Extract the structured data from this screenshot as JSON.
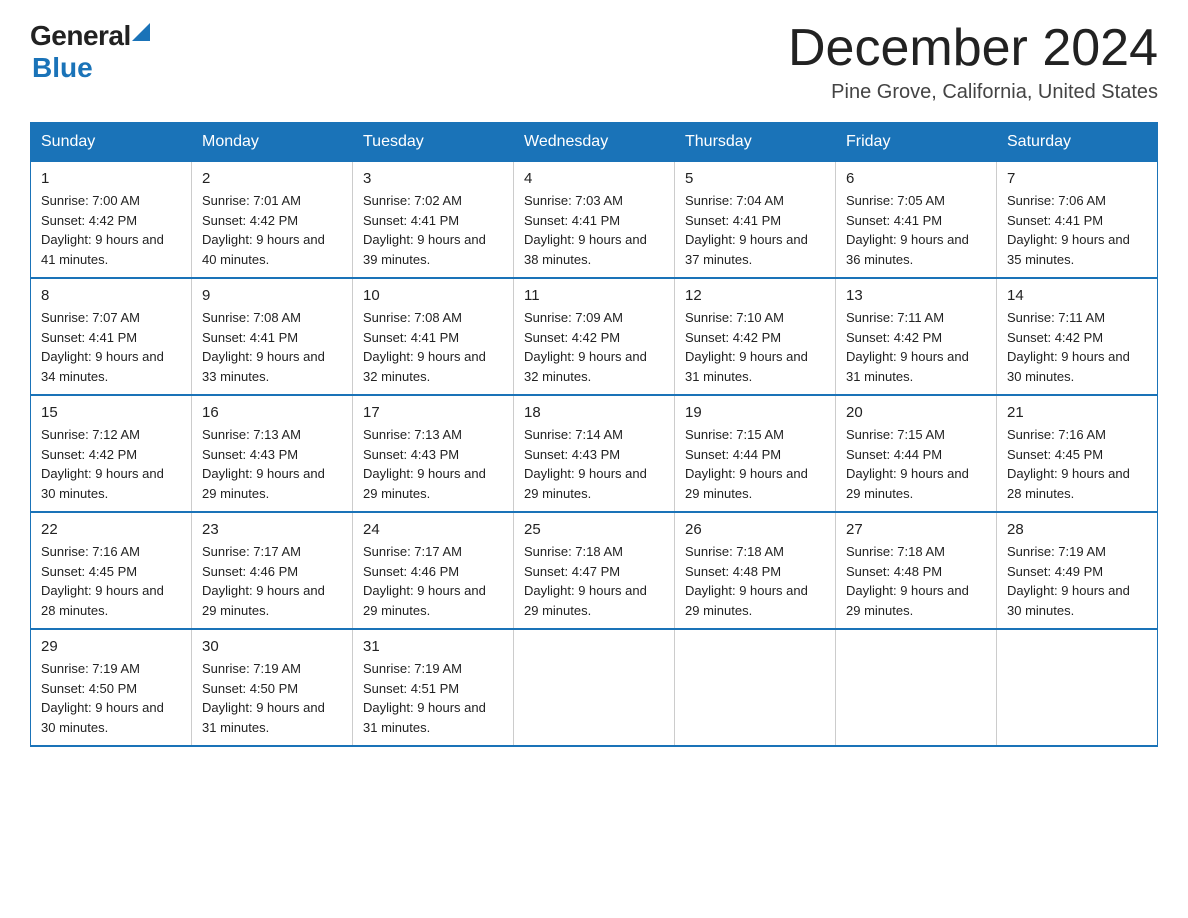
{
  "header": {
    "logo_general": "General",
    "logo_blue": "Blue",
    "title": "December 2024",
    "subtitle": "Pine Grove, California, United States"
  },
  "days_of_week": [
    "Sunday",
    "Monday",
    "Tuesday",
    "Wednesday",
    "Thursday",
    "Friday",
    "Saturday"
  ],
  "weeks": [
    [
      {
        "date": "1",
        "sunrise": "7:00 AM",
        "sunset": "4:42 PM",
        "daylight": "9 hours and 41 minutes."
      },
      {
        "date": "2",
        "sunrise": "7:01 AM",
        "sunset": "4:42 PM",
        "daylight": "9 hours and 40 minutes."
      },
      {
        "date": "3",
        "sunrise": "7:02 AM",
        "sunset": "4:41 PM",
        "daylight": "9 hours and 39 minutes."
      },
      {
        "date": "4",
        "sunrise": "7:03 AM",
        "sunset": "4:41 PM",
        "daylight": "9 hours and 38 minutes."
      },
      {
        "date": "5",
        "sunrise": "7:04 AM",
        "sunset": "4:41 PM",
        "daylight": "9 hours and 37 minutes."
      },
      {
        "date": "6",
        "sunrise": "7:05 AM",
        "sunset": "4:41 PM",
        "daylight": "9 hours and 36 minutes."
      },
      {
        "date": "7",
        "sunrise": "7:06 AM",
        "sunset": "4:41 PM",
        "daylight": "9 hours and 35 minutes."
      }
    ],
    [
      {
        "date": "8",
        "sunrise": "7:07 AM",
        "sunset": "4:41 PM",
        "daylight": "9 hours and 34 minutes."
      },
      {
        "date": "9",
        "sunrise": "7:08 AM",
        "sunset": "4:41 PM",
        "daylight": "9 hours and 33 minutes."
      },
      {
        "date": "10",
        "sunrise": "7:08 AM",
        "sunset": "4:41 PM",
        "daylight": "9 hours and 32 minutes."
      },
      {
        "date": "11",
        "sunrise": "7:09 AM",
        "sunset": "4:42 PM",
        "daylight": "9 hours and 32 minutes."
      },
      {
        "date": "12",
        "sunrise": "7:10 AM",
        "sunset": "4:42 PM",
        "daylight": "9 hours and 31 minutes."
      },
      {
        "date": "13",
        "sunrise": "7:11 AM",
        "sunset": "4:42 PM",
        "daylight": "9 hours and 31 minutes."
      },
      {
        "date": "14",
        "sunrise": "7:11 AM",
        "sunset": "4:42 PM",
        "daylight": "9 hours and 30 minutes."
      }
    ],
    [
      {
        "date": "15",
        "sunrise": "7:12 AM",
        "sunset": "4:42 PM",
        "daylight": "9 hours and 30 minutes."
      },
      {
        "date": "16",
        "sunrise": "7:13 AM",
        "sunset": "4:43 PM",
        "daylight": "9 hours and 29 minutes."
      },
      {
        "date": "17",
        "sunrise": "7:13 AM",
        "sunset": "4:43 PM",
        "daylight": "9 hours and 29 minutes."
      },
      {
        "date": "18",
        "sunrise": "7:14 AM",
        "sunset": "4:43 PM",
        "daylight": "9 hours and 29 minutes."
      },
      {
        "date": "19",
        "sunrise": "7:15 AM",
        "sunset": "4:44 PM",
        "daylight": "9 hours and 29 minutes."
      },
      {
        "date": "20",
        "sunrise": "7:15 AM",
        "sunset": "4:44 PM",
        "daylight": "9 hours and 29 minutes."
      },
      {
        "date": "21",
        "sunrise": "7:16 AM",
        "sunset": "4:45 PM",
        "daylight": "9 hours and 28 minutes."
      }
    ],
    [
      {
        "date": "22",
        "sunrise": "7:16 AM",
        "sunset": "4:45 PM",
        "daylight": "9 hours and 28 minutes."
      },
      {
        "date": "23",
        "sunrise": "7:17 AM",
        "sunset": "4:46 PM",
        "daylight": "9 hours and 29 minutes."
      },
      {
        "date": "24",
        "sunrise": "7:17 AM",
        "sunset": "4:46 PM",
        "daylight": "9 hours and 29 minutes."
      },
      {
        "date": "25",
        "sunrise": "7:18 AM",
        "sunset": "4:47 PM",
        "daylight": "9 hours and 29 minutes."
      },
      {
        "date": "26",
        "sunrise": "7:18 AM",
        "sunset": "4:48 PM",
        "daylight": "9 hours and 29 minutes."
      },
      {
        "date": "27",
        "sunrise": "7:18 AM",
        "sunset": "4:48 PM",
        "daylight": "9 hours and 29 minutes."
      },
      {
        "date": "28",
        "sunrise": "7:19 AM",
        "sunset": "4:49 PM",
        "daylight": "9 hours and 30 minutes."
      }
    ],
    [
      {
        "date": "29",
        "sunrise": "7:19 AM",
        "sunset": "4:50 PM",
        "daylight": "9 hours and 30 minutes."
      },
      {
        "date": "30",
        "sunrise": "7:19 AM",
        "sunset": "4:50 PM",
        "daylight": "9 hours and 31 minutes."
      },
      {
        "date": "31",
        "sunrise": "7:19 AM",
        "sunset": "4:51 PM",
        "daylight": "9 hours and 31 minutes."
      },
      null,
      null,
      null,
      null
    ]
  ],
  "labels": {
    "sunrise": "Sunrise:",
    "sunset": "Sunset:",
    "daylight": "Daylight:"
  },
  "colors": {
    "header_bg": "#1a73b8",
    "header_text": "#ffffff",
    "border": "#1a73b8"
  }
}
